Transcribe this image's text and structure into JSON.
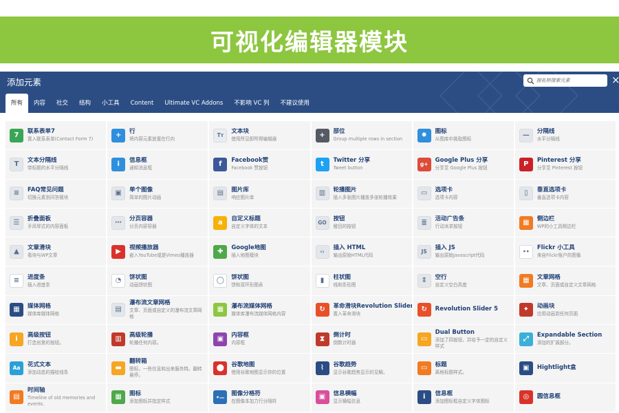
{
  "banner": {
    "title": "可视化编辑器模块"
  },
  "panel": {
    "title": "添加元素",
    "search_placeholder": "按名称搜索元素",
    "close": "×"
  },
  "tabs": [
    "所有",
    "内容",
    "社交",
    "结构",
    "小工具",
    "Content",
    "Ultimate VC Addons",
    "不影响 VC 列",
    "不建议使用"
  ],
  "elements": [
    {
      "title": "联系表单7",
      "desc": "置入联系表单(Contact Form 7)",
      "icon": "contact-form-7-icon",
      "color": "#3aa655",
      "glyph": "7"
    },
    {
      "title": "行",
      "desc": "将内容元素放置在行内",
      "icon": "row-plus-icon",
      "color": "#2f8fdc",
      "glyph": "+"
    },
    {
      "title": "文本块",
      "desc": "使用所见即所得编辑器",
      "icon": "text-block-icon",
      "color": "#e9edf2",
      "glyph": "Tт"
    },
    {
      "title": "部位",
      "desc": "Group multiple rows in section",
      "icon": "section-plus-icon",
      "color": "#555a64",
      "glyph": "+"
    },
    {
      "title": "图标",
      "desc": "从图库中挑取图标",
      "icon": "icon-gear-icon",
      "color": "#2f8fdc",
      "glyph": "✹"
    },
    {
      "title": "分隔线",
      "desc": "水平分隔线",
      "icon": "separator-icon",
      "color": "#e3e6ea",
      "glyph": "—"
    },
    {
      "title": "文本分隔线",
      "desc": "带标题的水平分隔线",
      "icon": "text-separator-icon",
      "color": "#e3e6ea",
      "glyph": "T"
    },
    {
      "title": "信息框",
      "desc": "通知消息框",
      "icon": "message-box-icon",
      "color": "#2f8fdc",
      "glyph": "i"
    },
    {
      "title": "Facebook赞",
      "desc": "Facebook 赞按钮",
      "icon": "facebook-icon",
      "color": "#3b5998",
      "glyph": "f"
    },
    {
      "title": "Twitter 分享",
      "desc": "Tweet button",
      "icon": "twitter-icon",
      "color": "#1da1f2",
      "glyph": "t"
    },
    {
      "title": "Google Plus 分享",
      "desc": "分享至 Google Plus 按钮",
      "icon": "google-plus-icon",
      "color": "#dd4b39",
      "glyph": "g+"
    },
    {
      "title": "Pinterest 分享",
      "desc": "分享至 Pinterest 按钮",
      "icon": "pinterest-icon",
      "color": "#cb2027",
      "glyph": "P"
    },
    {
      "title": "FAQ常见问题",
      "desc": "切换元素到问答模块",
      "icon": "faq-toggle-icon",
      "color": "#e3e6ea",
      "glyph": "≡"
    },
    {
      "title": "单个图像",
      "desc": "简单的图片动画",
      "icon": "single-image-icon",
      "color": "#e3e6ea",
      "glyph": "▣"
    },
    {
      "title": "图片库",
      "desc": "响应图片库",
      "icon": "image-gallery-icon",
      "color": "#e3e6ea",
      "glyph": "▤"
    },
    {
      "title": "轮播图片",
      "desc": "插入多张图片播放多张轮播效果",
      "icon": "image-carousel-icon",
      "color": "#e3e6ea",
      "glyph": "▥"
    },
    {
      "title": "选项卡",
      "desc": "选项卡内容",
      "icon": "tabs-icon",
      "color": "#e3e6ea",
      "glyph": "▭"
    },
    {
      "title": "垂直选项卡",
      "desc": "垂直选项卡内容",
      "icon": "vertical-tabs-icon",
      "color": "#e3e6ea",
      "glyph": "▯"
    },
    {
      "title": "折叠面板",
      "desc": "手风琴式的内容面板",
      "icon": "accordion-icon",
      "color": "#e3e6ea",
      "glyph": "☰"
    },
    {
      "title": "分页容器",
      "desc": "分页内容容器",
      "icon": "pageable-container-icon",
      "color": "#e3e6ea",
      "glyph": "⋯"
    },
    {
      "title": "自定义标题",
      "desc": "自定义字体的文本",
      "icon": "custom-heading-icon",
      "color": "#f5b20a",
      "glyph": "a"
    },
    {
      "title": "按钮",
      "desc": "醒目的按钮",
      "icon": "button-go-icon",
      "color": "#e3e6ea",
      "glyph": "GO"
    },
    {
      "title": "活动广告条",
      "desc": "行动派求按钮",
      "icon": "call-to-action-icon",
      "color": "#e3e6ea",
      "glyph": "≣"
    },
    {
      "title": "侧边栏",
      "desc": "WP的小工具侧边栏",
      "icon": "widget-sidebar-icon",
      "color": "#f07b22",
      "glyph": "▦"
    },
    {
      "title": "文章滑块",
      "desc": "看块与WP文章",
      "icon": "posts-slider-icon",
      "color": "#e3e6ea",
      "glyph": "▲"
    },
    {
      "title": "视频播放器",
      "desc": "嵌入YouTube或是Vimeo播放器",
      "icon": "video-player-icon",
      "color": "#d9322b",
      "glyph": "▶"
    },
    {
      "title": "Google地图",
      "desc": "插入地图模块",
      "icon": "google-maps-icon",
      "color": "#4fa84a",
      "glyph": "✚"
    },
    {
      "title": "插入 HTML",
      "desc": "输出原始HTML代码",
      "icon": "raw-html-icon",
      "color": "#e3e6ea",
      "glyph": "‹›"
    },
    {
      "title": "插入 JS",
      "desc": "输出原始Javascript代码",
      "icon": "raw-js-icon",
      "color": "#e3e6ea",
      "glyph": "JS"
    },
    {
      "title": "Flickr 小工具",
      "desc": "来自Flickr账户的图像",
      "icon": "flickr-icon",
      "color": "#ffffff",
      "glyph": "••"
    },
    {
      "title": "进度条",
      "desc": "插入进度条",
      "icon": "progress-bar-icon",
      "color": "#ffffff",
      "glyph": "≡"
    },
    {
      "title": "饼状图",
      "desc": "动画饼状图",
      "icon": "pie-chart-icon",
      "color": "#ffffff",
      "glyph": "◔"
    },
    {
      "title": "饼状图",
      "desc": "饼和双环形图表",
      "icon": "round-chart-icon",
      "color": "#ffffff",
      "glyph": "◯"
    },
    {
      "title": "柱状图",
      "desc": "线和条形图",
      "icon": "line-chart-icon",
      "color": "#ffffff",
      "glyph": "▮"
    },
    {
      "title": "空行",
      "desc": "自定义空白高度",
      "icon": "empty-space-icon",
      "color": "#e3e6ea",
      "glyph": "⇕"
    },
    {
      "title": "文章网格",
      "desc": "文章、页面或自定义文章网格",
      "icon": "post-grid-icon",
      "color": "#f07b22",
      "glyph": "▦"
    },
    {
      "title": "媒体网格",
      "desc": "媒体库媒体网格",
      "icon": "media-grid-icon",
      "color": "#2b4d84",
      "glyph": "▦"
    },
    {
      "title": "瀑布流文章网格",
      "desc": "文章、页面或自定义的瀑布流文章网格",
      "icon": "masonry-grid-icon",
      "color": "#e3e6ea",
      "glyph": "▤"
    },
    {
      "title": "瀑布流媒体网格",
      "desc": "媒体库瀑布流媒体网格内容",
      "icon": "masonry-media-grid-icon",
      "color": "#8dc63f",
      "glyph": "▦"
    },
    {
      "title": "革命滑块Revolution Slider",
      "desc": "置入革命滑块",
      "icon": "revolution-slider-icon",
      "color": "#e8502a",
      "glyph": "↻"
    },
    {
      "title": "Revolution Slider 5",
      "desc": "",
      "icon": "revolution-slider-5-icon",
      "color": "#e8502a",
      "glyph": "↻"
    },
    {
      "title": "动画块",
      "desc": "应用动画到任何页面",
      "icon": "animated-block-icon",
      "color": "#c0392b",
      "glyph": "✦"
    },
    {
      "title": "高级按钮",
      "desc": "打造创意的按钮。",
      "icon": "advanced-button-icon",
      "color": "#f5a623",
      "glyph": "i"
    },
    {
      "title": "高级轮播",
      "desc": "轮播任何内容。",
      "icon": "advanced-carousel-icon",
      "color": "#c0392b",
      "glyph": "▥"
    },
    {
      "title": "内容框",
      "desc": "内容框",
      "icon": "content-box-icon",
      "color": "#8e44ad",
      "glyph": "▣"
    },
    {
      "title": "倒计时",
      "desc": "倒数计时器",
      "icon": "countdown-icon",
      "color": "#c0392b",
      "glyph": "⧗"
    },
    {
      "title": "Dual Button",
      "desc": "添加了四按钮，并给予一定的自定义样式",
      "icon": "dual-button-icon",
      "color": "#f5a623",
      "glyph": "▭"
    },
    {
      "title": "Expandable Section",
      "desc": "添加的扩展部分。",
      "icon": "expandable-section-icon",
      "color": "#3ab0d8",
      "glyph": "⤢"
    },
    {
      "title": "花式文本",
      "desc": "添加动态的描绘线条",
      "icon": "fancy-text-icon",
      "color": "#2aa0d8",
      "glyph": "Aa"
    },
    {
      "title": "翻转箱",
      "desc": "图标，一些信息和出来服务特。翻转悬停。",
      "icon": "flip-box-icon",
      "color": "#f5a623",
      "glyph": "▬"
    },
    {
      "title": "谷歌地图",
      "desc": "使用谷歌地图显示你的位置",
      "icon": "ult-google-map-icon",
      "color": "#d9322b",
      "glyph": "⬤"
    },
    {
      "title": "谷歌趋势",
      "desc": "显示谷歌趋势显示的见解。",
      "icon": "google-trends-icon",
      "color": "#2b4d84",
      "glyph": "⌇"
    },
    {
      "title": "标题",
      "desc": "离格标题样式。",
      "icon": "ult-heading-icon",
      "color": "#f07b22",
      "glyph": "▭"
    },
    {
      "title": "Hightlight盒",
      "desc": "",
      "icon": "highlight-box-icon",
      "color": "#2b4d84",
      "glyph": "▣"
    },
    {
      "title": "时间轴",
      "desc": "Timeline of old memories and events.",
      "icon": "timeline-icon",
      "color": "#f07b22",
      "glyph": "▤"
    },
    {
      "title": "图标",
      "desc": "添加图标并指定样式",
      "icon": "ult-icons-icon",
      "color": "#4fa84a",
      "glyph": "▦"
    },
    {
      "title": "图像分格符",
      "desc": "在图像本加力行分隔符",
      "icon": "image-separator-icon",
      "color": "#2b6fb6",
      "glyph": "•—"
    },
    {
      "title": "信息横幅",
      "desc": "显示横幅信息",
      "icon": "info-banner-icon",
      "color": "#d94f9a",
      "glyph": "▣"
    },
    {
      "title": "信息框",
      "desc": "添加图标框自定义字体图标",
      "icon": "info-box-icon",
      "color": "#2b4d84",
      "glyph": "i"
    },
    {
      "title": "圆信息框",
      "desc": "",
      "icon": "info-circle-icon",
      "color": "#d9322b",
      "glyph": "◎"
    }
  ]
}
